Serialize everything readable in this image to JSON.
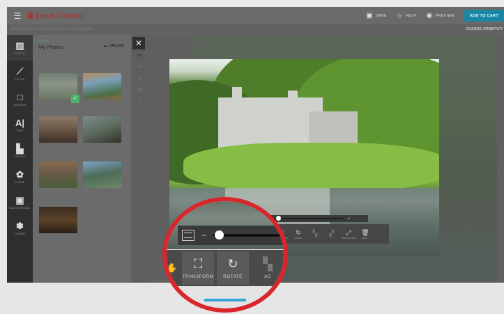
{
  "app": {
    "brand": "Jean Coutu",
    "project_title": "8x10 Black Framed Canvas, Landscape",
    "change_orientation": "CHANGE ORIENTATI"
  },
  "topbar": {
    "save": "SAVE",
    "help": "HELP",
    "preview": "PREVIEW",
    "add_to_cart": "ADD TO CART"
  },
  "rail": {
    "items": [
      {
        "label": "PHOTO",
        "icon": "image-icon"
      },
      {
        "label": "FILTER",
        "icon": "wand-icon"
      },
      {
        "label": "BORDER",
        "icon": "square-icon"
      },
      {
        "label": "TEXT",
        "icon": "text-icon"
      },
      {
        "label": "LAYOUT",
        "icon": "layout-icon"
      },
      {
        "label": "THEME",
        "icon": "palette-icon"
      },
      {
        "label": "BACKGROUND",
        "icon": "background-icon"
      },
      {
        "label": "CLIPART",
        "icon": "clipart-icon"
      }
    ]
  },
  "panel": {
    "back": "< BACK",
    "title": "My Photos",
    "upload": "UPLOAD"
  },
  "toolbar": {
    "items": [
      "TRANSFORM",
      "ROTATE",
      "",
      "",
      "BACKGROUND",
      "EMPTY"
    ]
  },
  "magnifier": {
    "transform": "TRANSFORM",
    "rotate": "ROTATE",
    "partial": "AC"
  },
  "colors": {
    "accent_red": "#d9262b",
    "cart_blue": "#1a87a6",
    "brand_red": "#a33a3a"
  }
}
